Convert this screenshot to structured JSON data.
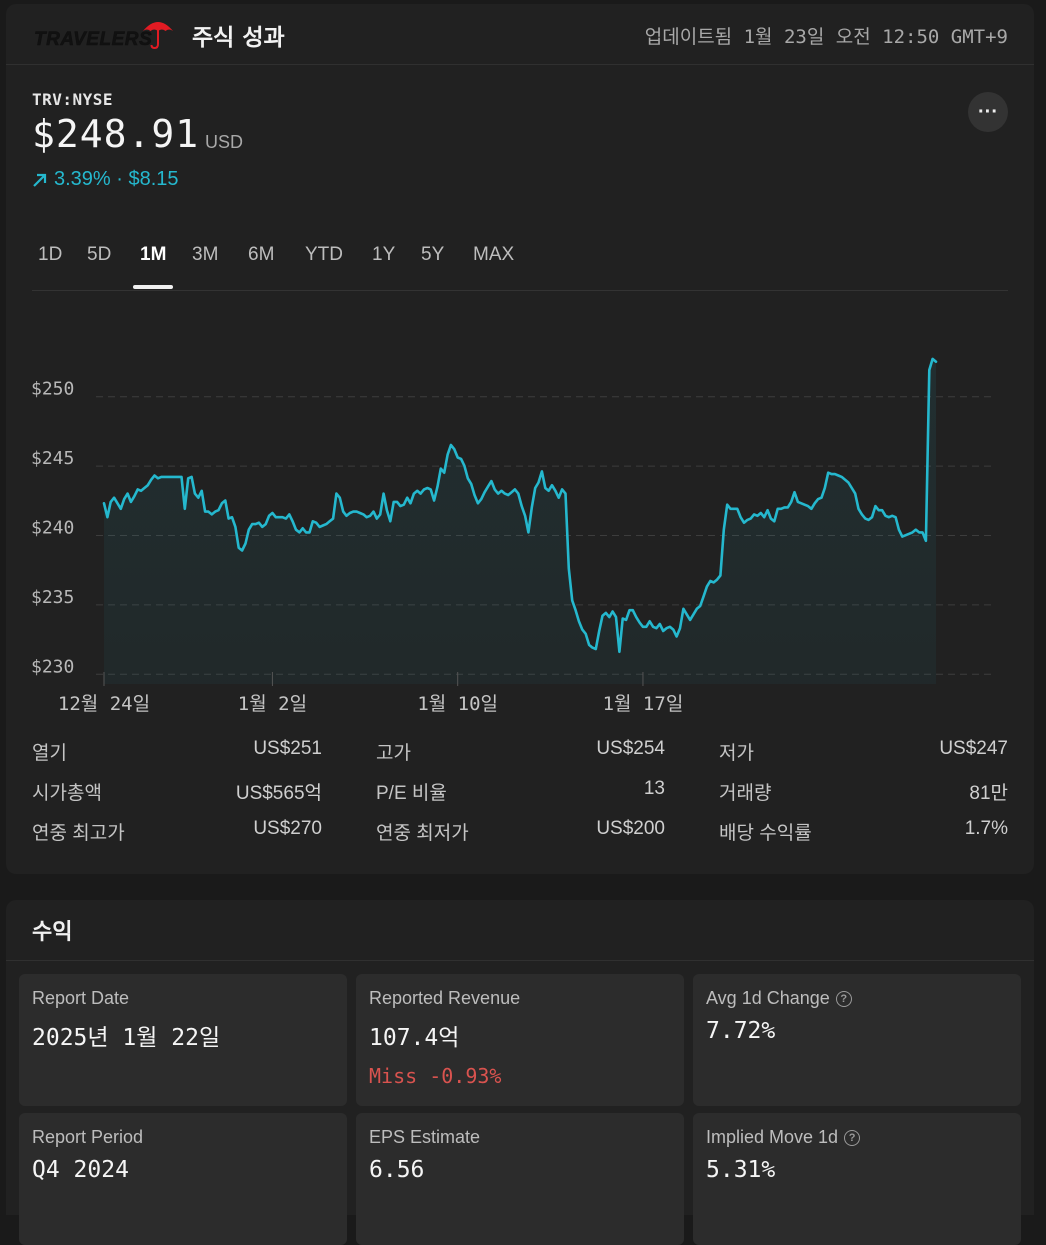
{
  "header": {
    "brand": "TRAVELERS",
    "title": "주식 성과",
    "updated": "업데이트됨 1월 23일 오전 12:50 GMT+9"
  },
  "quote": {
    "ticker": "TRV:NYSE",
    "price": "$248.91",
    "currency": "USD",
    "change": "3.39% · $8.15",
    "change_color": "#25b8ce",
    "more_label": "···"
  },
  "tabs": [
    {
      "label": "1D"
    },
    {
      "label": "5D"
    },
    {
      "label": "1M",
      "active": true
    },
    {
      "label": "3M"
    },
    {
      "label": "6M"
    },
    {
      "label": "YTD"
    },
    {
      "label": "1Y"
    },
    {
      "label": "5Y"
    },
    {
      "label": "MAX"
    }
  ],
  "chart_data": {
    "type": "line",
    "y_ticks": [
      "$250",
      "$245",
      "$240",
      "$235",
      "$230"
    ],
    "ylim": [
      229.3,
      252.5
    ],
    "x_ticks": [
      "12월 24일",
      "1월 2일",
      "1월 10일",
      "1월 17일"
    ],
    "x_tick_index": [
      0,
      50,
      105,
      160
    ],
    "series": [
      {
        "color": "#25b8ce",
        "values": [
          241.6,
          240.6,
          241.7,
          242.0,
          241.6,
          241.2,
          241.9,
          242.3,
          241.7,
          242.1,
          242.6,
          242.5,
          242.7,
          242.9,
          243.3,
          243.6,
          243.4,
          243.5,
          243.5,
          243.5,
          243.5,
          243.5,
          243.5,
          243.5,
          241.2,
          243.4,
          243.5,
          242.3,
          242.0,
          242.5,
          241.0,
          241.0,
          240.8,
          241.0,
          241.1,
          241.6,
          241.8,
          240.5,
          240.6,
          239.9,
          238.4,
          238.2,
          238.7,
          239.7,
          240.1,
          240.1,
          240.2,
          239.9,
          240.1,
          240.7,
          240.9,
          240.6,
          240.6,
          240.6,
          240.5,
          240.8,
          240.3,
          239.7,
          239.5,
          239.8,
          239.5,
          239.5,
          240.3,
          240.2,
          239.9,
          240.0,
          240.1,
          240.3,
          240.5,
          242.3,
          242.0,
          241.0,
          240.7,
          240.9,
          241.0,
          241.0,
          240.9,
          240.8,
          240.6,
          240.7,
          241.0,
          240.5,
          240.8,
          242.3,
          241.1,
          240.3,
          241.7,
          241.7,
          241.4,
          241.5,
          242.0,
          241.6,
          242.3,
          242.5,
          242.3,
          242.6,
          242.7,
          242.6,
          241.8,
          242.8,
          244.1,
          243.8,
          245.1,
          245.8,
          245.5,
          244.9,
          244.8,
          244.3,
          243.4,
          243.0,
          242.2,
          241.6,
          241.9,
          242.4,
          242.8,
          243.2,
          242.6,
          242.3,
          242.5,
          242.3,
          242.2,
          242.4,
          242.6,
          242.3,
          241.4,
          240.7,
          239.5,
          241.3,
          242.7,
          243.1,
          243.9,
          242.7,
          242.5,
          242.9,
          242.5,
          242.0,
          242.6,
          242.3,
          236.9,
          234.6,
          233.9,
          233.1,
          232.5,
          232.2,
          231.4,
          231.2,
          231.1,
          232.4,
          233.5,
          233.7,
          233.4,
          233.8,
          233.4,
          230.9,
          233.3,
          233.2,
          233.9,
          233.9,
          233.4,
          233.0,
          232.7,
          232.7,
          233.1,
          232.7,
          232.6,
          232.9,
          232.4,
          232.6,
          232.7,
          232.5,
          232.0,
          232.6,
          234.0,
          233.6,
          233.2,
          233.6,
          234.0,
          234.2,
          234.9,
          235.6,
          236.0,
          235.9,
          236.1,
          236.4,
          239.7,
          241.5,
          241.2,
          241.2,
          241.2,
          240.6,
          240.2,
          240.4,
          240.5,
          240.8,
          240.7,
          240.9,
          240.6,
          241.1,
          240.5,
          240.3,
          241.2,
          241.2,
          241.3,
          241.3,
          241.7,
          242.4,
          241.7,
          241.6,
          241.5,
          241.4,
          241.2,
          241.6,
          241.9,
          242.0,
          242.7,
          243.8,
          243.7,
          243.7,
          243.6,
          243.5,
          243.3,
          243.1,
          242.7,
          242.3,
          241.2,
          240.8,
          240.5,
          240.4,
          240.6,
          241.4,
          241.1,
          241.1,
          240.7,
          240.6,
          240.7,
          240.6,
          239.7,
          239.2,
          239.3,
          239.4,
          239.5,
          239.7,
          239.5,
          239.5,
          238.9,
          251.2,
          252.0,
          251.8
        ]
      }
    ]
  },
  "stats": [
    {
      "label": "열기",
      "value": "US$251"
    },
    {
      "label": "고가",
      "value": "US$254"
    },
    {
      "label": "저가",
      "value": "US$247"
    },
    {
      "label": "시가총액",
      "value": "US$565억"
    },
    {
      "label": "P/E 비율",
      "value": "13"
    },
    {
      "label": "거래량",
      "value": "81만"
    },
    {
      "label": "연중 최고가",
      "value": "US$270"
    },
    {
      "label": "연중 최저가",
      "value": "US$200"
    },
    {
      "label": "배당 수익률",
      "value": "1.7%"
    }
  ],
  "earnings": {
    "title": "수익",
    "tiles": [
      {
        "label": "Report Date",
        "value": "2025년 1월 22일"
      },
      {
        "label": "Reported Revenue",
        "value": "107.4억",
        "note": "Miss -0.93%"
      },
      {
        "label": "Avg 1d Change",
        "value": "7.72%",
        "help": "?"
      },
      {
        "label": "Report Period",
        "value": "Q4 2024"
      },
      {
        "label": "EPS Estimate",
        "value": "6.56"
      },
      {
        "label": "Implied Move 1d",
        "value": "5.31%",
        "help": "?"
      }
    ]
  }
}
